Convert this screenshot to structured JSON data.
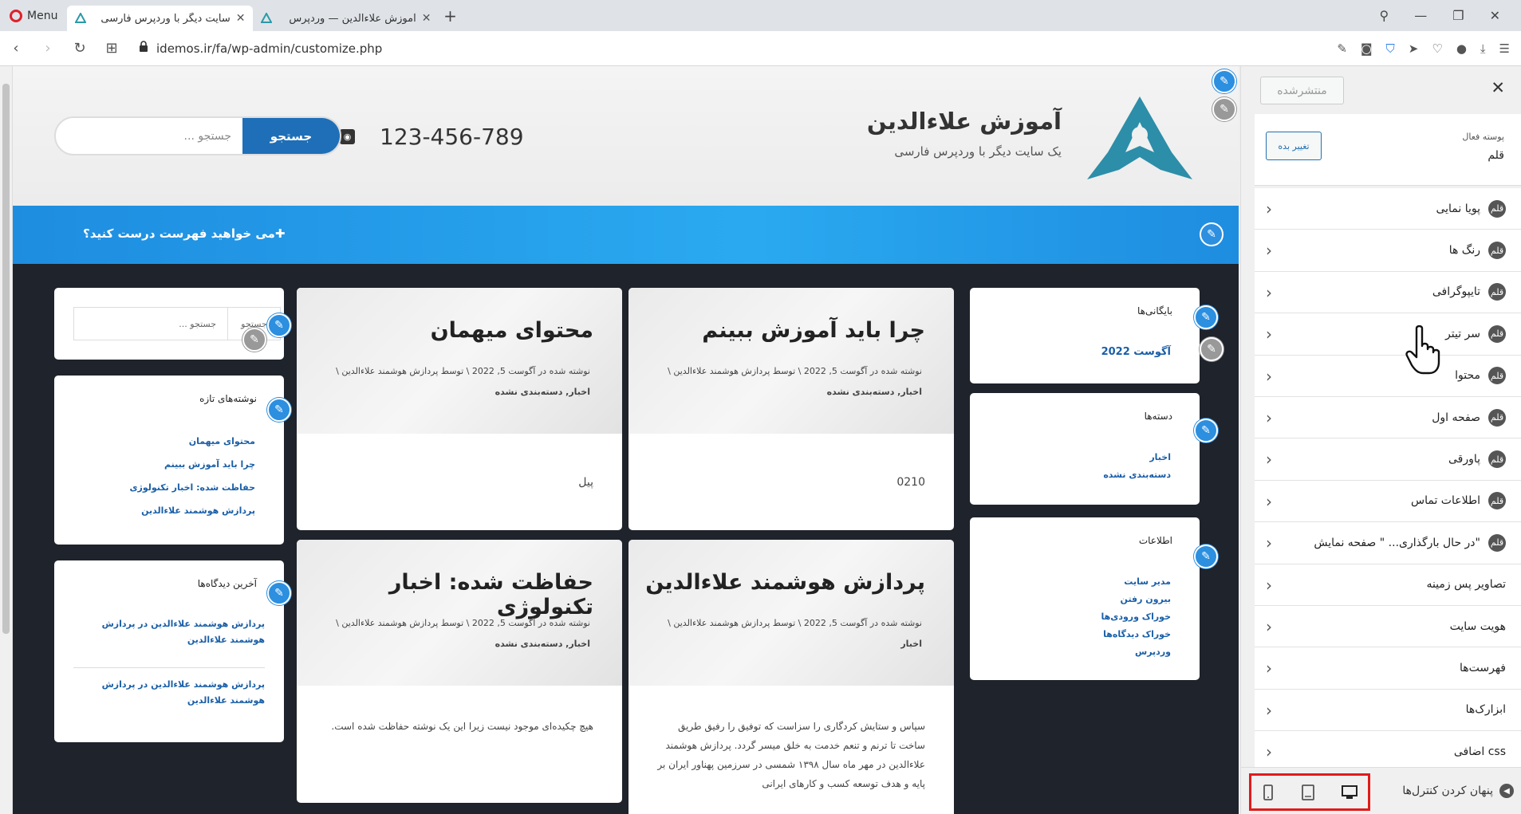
{
  "browser": {
    "menu_label": "Menu",
    "tabs": [
      {
        "title": "سایت دیگر با وردپرس فارسی",
        "active": true
      },
      {
        "title": "آموزش علاءالدین — وردپرس",
        "active": false
      }
    ],
    "url": "idemos.ir/fa/wp-admin/customize.php"
  },
  "site": {
    "title": "آموزش علاءالدین",
    "tagline": "یک سایت دیگر با وردپرس فارسی",
    "phone": "123-456-789",
    "search_button": "جستجو",
    "search_placeholder": "جستجو ...",
    "menu_prompt": "می خواهید فهرست درست کنید؟"
  },
  "posts": [
    {
      "title": "چرا باید آموزش ببینم",
      "meta": "نوشته شده در آگوست 5, 2022  \\  توسط پردازش هوشمند علاءالدین  \\",
      "cats": "اخبار, دسته‌بندی نشده",
      "excerpt": "0210"
    },
    {
      "title": "محتوای میهمان",
      "meta": "نوشته شده در آگوست 5, 2022  \\  توسط پردازش هوشمند علاءالدین  \\",
      "cats": "اخبار, دسته‌بندی نشده",
      "excerpt": "پیل"
    },
    {
      "title": "پردازش هوشمند علاءالدین",
      "meta": "نوشته شده در آگوست 5, 2022  \\  توسط پردازش هوشمند علاءالدین  \\",
      "cats": "اخبار",
      "excerpt": "سپاس و ستایش کردگاری را سزاست که توفیق را رفیق طریق ساخت تا ترنم و تنعم خدمت به خلق میسر گردد. پردازش هوشمند علاءالدین در مهر ماه سال ۱۳۹۸ شمسی در سرزمین پهناور ایران بر پایه و هدف توسعه کسب و کارهای ایرانی"
    },
    {
      "title": "حفاظت شده: اخبار تکنولوژی",
      "meta": "نوشته شده در آگوست 5, 2022  \\  توسط پردازش هوشمند علاءالدین  \\",
      "cats": "اخبار, دسته‌بندی نشده",
      "excerpt": "هیچ چکیده‌ای موجود نیست زیرا این یک نوشته حفاظت شده است."
    }
  ],
  "widgets": {
    "archives": {
      "title": "بایگانی‌ها",
      "items": [
        "آگوست 2022"
      ]
    },
    "categories": {
      "title": "دسته‌ها",
      "items": [
        "اخبار",
        "دسته‌بندی نشده"
      ]
    },
    "meta": {
      "title": "اطلاعات",
      "items": [
        "مدیر سایت",
        "بیرون رفتن",
        "خوراک ورودی‌ها",
        "خوراک دیدگاه‌ها",
        "وردپرس"
      ]
    },
    "search": {
      "button": "جستجو",
      "placeholder": "جستجو ..."
    },
    "recent_posts": {
      "title": "نوشته‌های تازه",
      "items": [
        "محتوای میهمان",
        "چرا باید آموزش ببینم",
        "حفاظت شده: اخبار تکنولوژی",
        "پردازش هوشمند علاءالدین"
      ]
    },
    "recent_comments": {
      "title": "آخرین دیدگاه‌ها",
      "items": [
        "پردازش هوشمند علاءالدین در پردازش هوشمند علاءالدین",
        "پردازش هوشمند علاءالدین در پردازش هوشمند علاءالدین"
      ]
    }
  },
  "customizer": {
    "publish_label": "منتشرشده",
    "active_theme_label": "پوسته فعال",
    "active_theme_name": "قلم",
    "change_label": "تغییر بده",
    "sections": [
      {
        "label": "پویا نمایی",
        "theme_icon": true
      },
      {
        "label": "رنگ ها",
        "theme_icon": true
      },
      {
        "label": "تایپوگرافی",
        "theme_icon": true
      },
      {
        "label": "سر تیتر",
        "theme_icon": true
      },
      {
        "label": "محتوا",
        "theme_icon": true
      },
      {
        "label": "صفحه اول",
        "theme_icon": true
      },
      {
        "label": "پاورقی",
        "theme_icon": true
      },
      {
        "label": "اطلاعات تماس",
        "theme_icon": true
      },
      {
        "label": "\"در حال بارگذاری... \" صفحه نمایش",
        "theme_icon": true
      },
      {
        "label": "تصاویر پس زمینه",
        "theme_icon": false
      },
      {
        "label": "هویت سایت",
        "theme_icon": false
      },
      {
        "label": "فهرست‌ها",
        "theme_icon": false
      },
      {
        "label": "ابزارک‌ها",
        "theme_icon": false
      },
      {
        "label": "css اضافی",
        "theme_icon": false
      }
    ],
    "hide_controls_label": "پنهان کردن کنترل‌ها",
    "theme_icon_glyph": "قلم",
    "highlight_color": "#e21a1a",
    "accent_color": "#2271b1"
  }
}
